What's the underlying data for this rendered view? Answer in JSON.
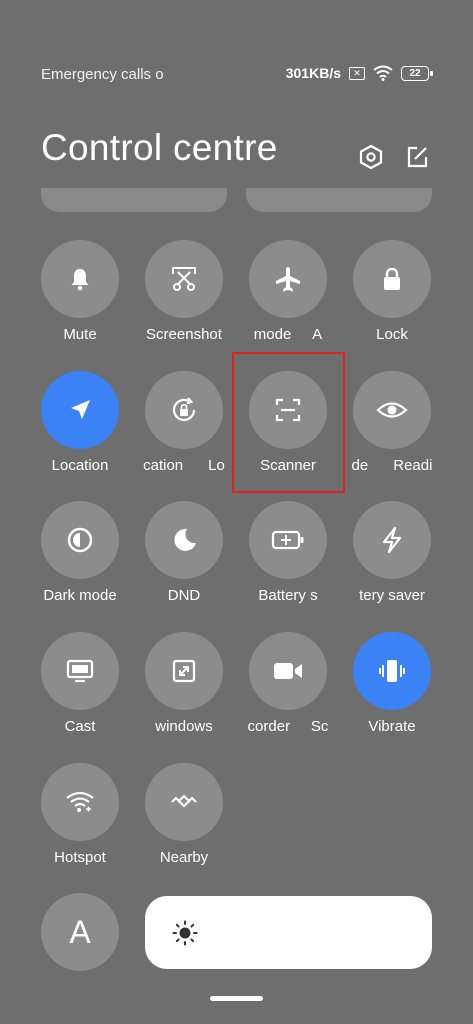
{
  "status_bar": {
    "left_text": "Emergency calls o",
    "speed": "301KB/s",
    "sim_icon": "sim-x-icon",
    "wifi_icon": "wifi-icon",
    "battery_level": "22"
  },
  "header": {
    "title": "Control centre",
    "settings_icon": "settings-hex-icon",
    "edit_icon": "edit-icon"
  },
  "tiles": [
    {
      "id": "mute",
      "label": "Mute",
      "icon": "bell-icon",
      "active": false
    },
    {
      "id": "screenshot",
      "label": "Screenshot",
      "icon": "screenshot-scissor-icon",
      "active": false
    },
    {
      "id": "airplane",
      "label": "mode",
      "label_extra": "A",
      "icon": "airplane-icon",
      "active": false
    },
    {
      "id": "lock",
      "label": "Lock",
      "icon": "lock-icon",
      "active": false
    },
    {
      "id": "location",
      "label": "Location",
      "icon": "location-arrow-icon",
      "active": true
    },
    {
      "id": "rotation",
      "label": "cation",
      "label_extra": "Lo",
      "icon": "rotation-lock-icon",
      "active": false
    },
    {
      "id": "scanner",
      "label": "Scanner",
      "icon": "scanner-icon",
      "active": false
    },
    {
      "id": "reading",
      "label": "de",
      "label_extra": "Readi",
      "icon": "eye-icon",
      "active": false
    },
    {
      "id": "darkmode",
      "label": "Dark mode",
      "icon": "dark-mode-icon",
      "active": false
    },
    {
      "id": "dnd",
      "label": "DND",
      "icon": "moon-icon",
      "active": false
    },
    {
      "id": "battery",
      "label": "Battery s",
      "icon": "battery-saver-icon",
      "active": false
    },
    {
      "id": "ultra",
      "label": "tery saver",
      "icon": "bolt-icon",
      "active": false
    },
    {
      "id": "cast",
      "label": "Cast",
      "icon": "cast-monitor-icon",
      "active": false
    },
    {
      "id": "floating",
      "label": "windows",
      "icon": "floating-window-icon",
      "active": false
    },
    {
      "id": "recorder",
      "label": "corder",
      "label_extra": "Sc",
      "icon": "video-recorder-icon",
      "active": false
    },
    {
      "id": "vibrate",
      "label": "Vibrate",
      "icon": "vibrate-icon",
      "active": true
    },
    {
      "id": "hotspot",
      "label": "Hotspot",
      "icon": "hotspot-icon",
      "active": false
    },
    {
      "id": "nearby",
      "label": "Nearby",
      "icon": "nearby-share-icon",
      "active": false
    }
  ],
  "bottom": {
    "font_button": "A",
    "brightness_icon": "sun-icon",
    "brightness_level": 0.0
  },
  "colors": {
    "background": "#6e6e6e",
    "tile": "#8c8c8c",
    "active": "#3b82f6",
    "highlight": "#d9231f"
  }
}
